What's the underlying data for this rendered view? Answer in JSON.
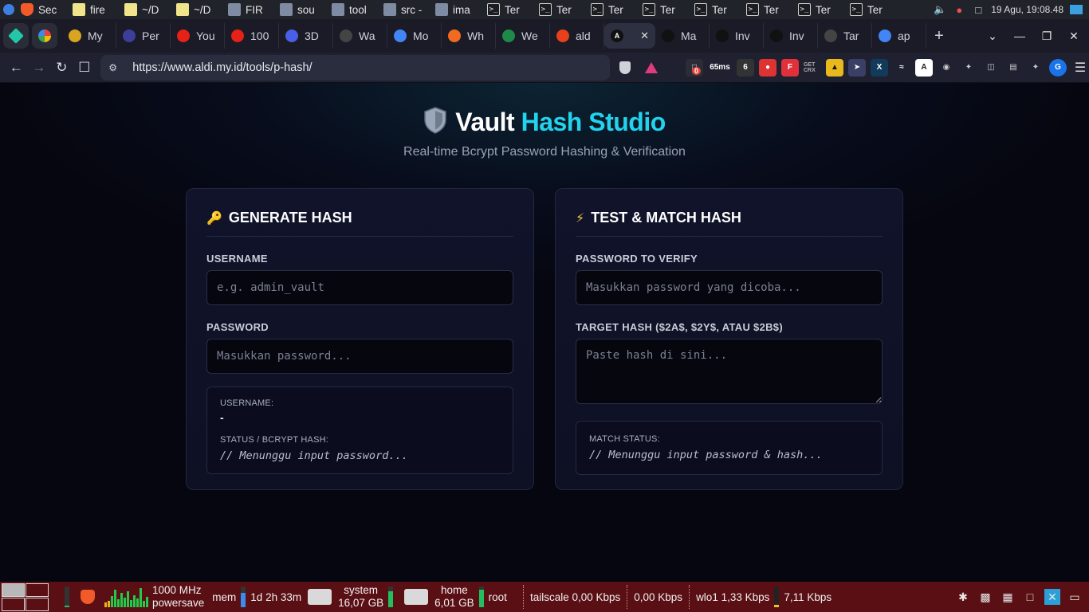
{
  "os_top": {
    "tasks": [
      {
        "label": "Sec",
        "icon": "brave",
        "active": false
      },
      {
        "label": "fire",
        "icon": "note",
        "active": false
      },
      {
        "label": "~/D",
        "icon": "note",
        "active": false
      },
      {
        "label": "~/D",
        "icon": "note",
        "active": false
      },
      {
        "label": "FIR",
        "icon": "folder",
        "active": false
      },
      {
        "label": "sou",
        "icon": "folder",
        "active": false
      },
      {
        "label": "tool",
        "icon": "folder",
        "active": false
      },
      {
        "label": "src -",
        "icon": "folder",
        "active": false
      },
      {
        "label": "ima",
        "icon": "folder",
        "active": false
      },
      {
        "label": "Ter",
        "icon": "term",
        "active": false
      },
      {
        "label": "Ter",
        "icon": "term",
        "active": false
      },
      {
        "label": "Ter",
        "icon": "term",
        "active": false
      },
      {
        "label": "Ter",
        "icon": "term",
        "active": false
      },
      {
        "label": "Ter",
        "icon": "term",
        "active": false
      },
      {
        "label": "Ter",
        "icon": "term",
        "active": false
      },
      {
        "label": "Ter",
        "icon": "term",
        "active": false
      },
      {
        "label": "Ter",
        "icon": "term",
        "active": false
      }
    ],
    "clock": "19 Agu, 19:08.48"
  },
  "tabs": [
    {
      "label": "My",
      "color": "#d9a520"
    },
    {
      "label": "Per",
      "color": "#3b3f9a"
    },
    {
      "label": "You",
      "color": "#e62117"
    },
    {
      "label": "100",
      "color": "#e62117"
    },
    {
      "label": "3D",
      "color": "#4b5ee8"
    },
    {
      "label": "Wa",
      "color": "#444"
    },
    {
      "label": "Mo",
      "color": "#4285f4"
    },
    {
      "label": "Wh",
      "color": "#f06a22"
    },
    {
      "label": "We",
      "color": "#1d8a4a"
    },
    {
      "label": "ald",
      "color": "#e8401a"
    },
    {
      "label": "Ma",
      "color": "#111"
    },
    {
      "label": "Inv",
      "color": "#111"
    },
    {
      "label": "Inv",
      "color": "#111"
    },
    {
      "label": "Tar",
      "color": "#444"
    },
    {
      "label": "ap",
      "color": "#4285f4"
    }
  ],
  "address": {
    "url": "https://www.aldi.my.id/tools/p-hash/"
  },
  "extensions": {
    "badge": "0",
    "ping": "65ms",
    "get_crx": "GET CRX"
  },
  "page": {
    "title_main": "Vault",
    "title_accent": "Hash Studio",
    "subtitle": "Real-time Bcrypt Password Hashing & Verification",
    "generate": {
      "heading": "GENERATE HASH",
      "username_label": "USERNAME",
      "username_placeholder": "e.g. admin_vault",
      "password_label": "PASSWORD",
      "password_placeholder": "Masukkan password...",
      "result_username_label": "USERNAME:",
      "result_username_value": "-",
      "result_status_label": "STATUS / BCRYPT HASH:",
      "result_status_value": "// Menunggu input password..."
    },
    "test": {
      "heading": "TEST & MATCH HASH",
      "password_label": "PASSWORD TO VERIFY",
      "password_placeholder": "Masukkan password yang dicoba...",
      "hash_label": "TARGET HASH ($2A$, $2Y$, ATAU $2B$)",
      "hash_placeholder": "Paste hash di sini...",
      "match_label": "MATCH STATUS:",
      "match_value": "// Menunggu input password & hash..."
    }
  },
  "os_bottom": {
    "cpu_freq": "1000 MHz",
    "cpu_gov": "powersave",
    "mem_label": "mem",
    "uptime": "1d 2h 33m",
    "system_label": "system",
    "system_size": "16,07 GB",
    "home_label": "home",
    "home_size": "6,01 GB",
    "root_label": "root",
    "tailscale": "tailscale 0,00 Kbps",
    "tailscale_up": "0,00 Kbps",
    "wlo1": "wlo1 1,33 Kbps",
    "wlo1_up": "7,11 Kbps"
  },
  "colors": {
    "accent": "#22d3ee",
    "panel": "#5a0f14"
  }
}
